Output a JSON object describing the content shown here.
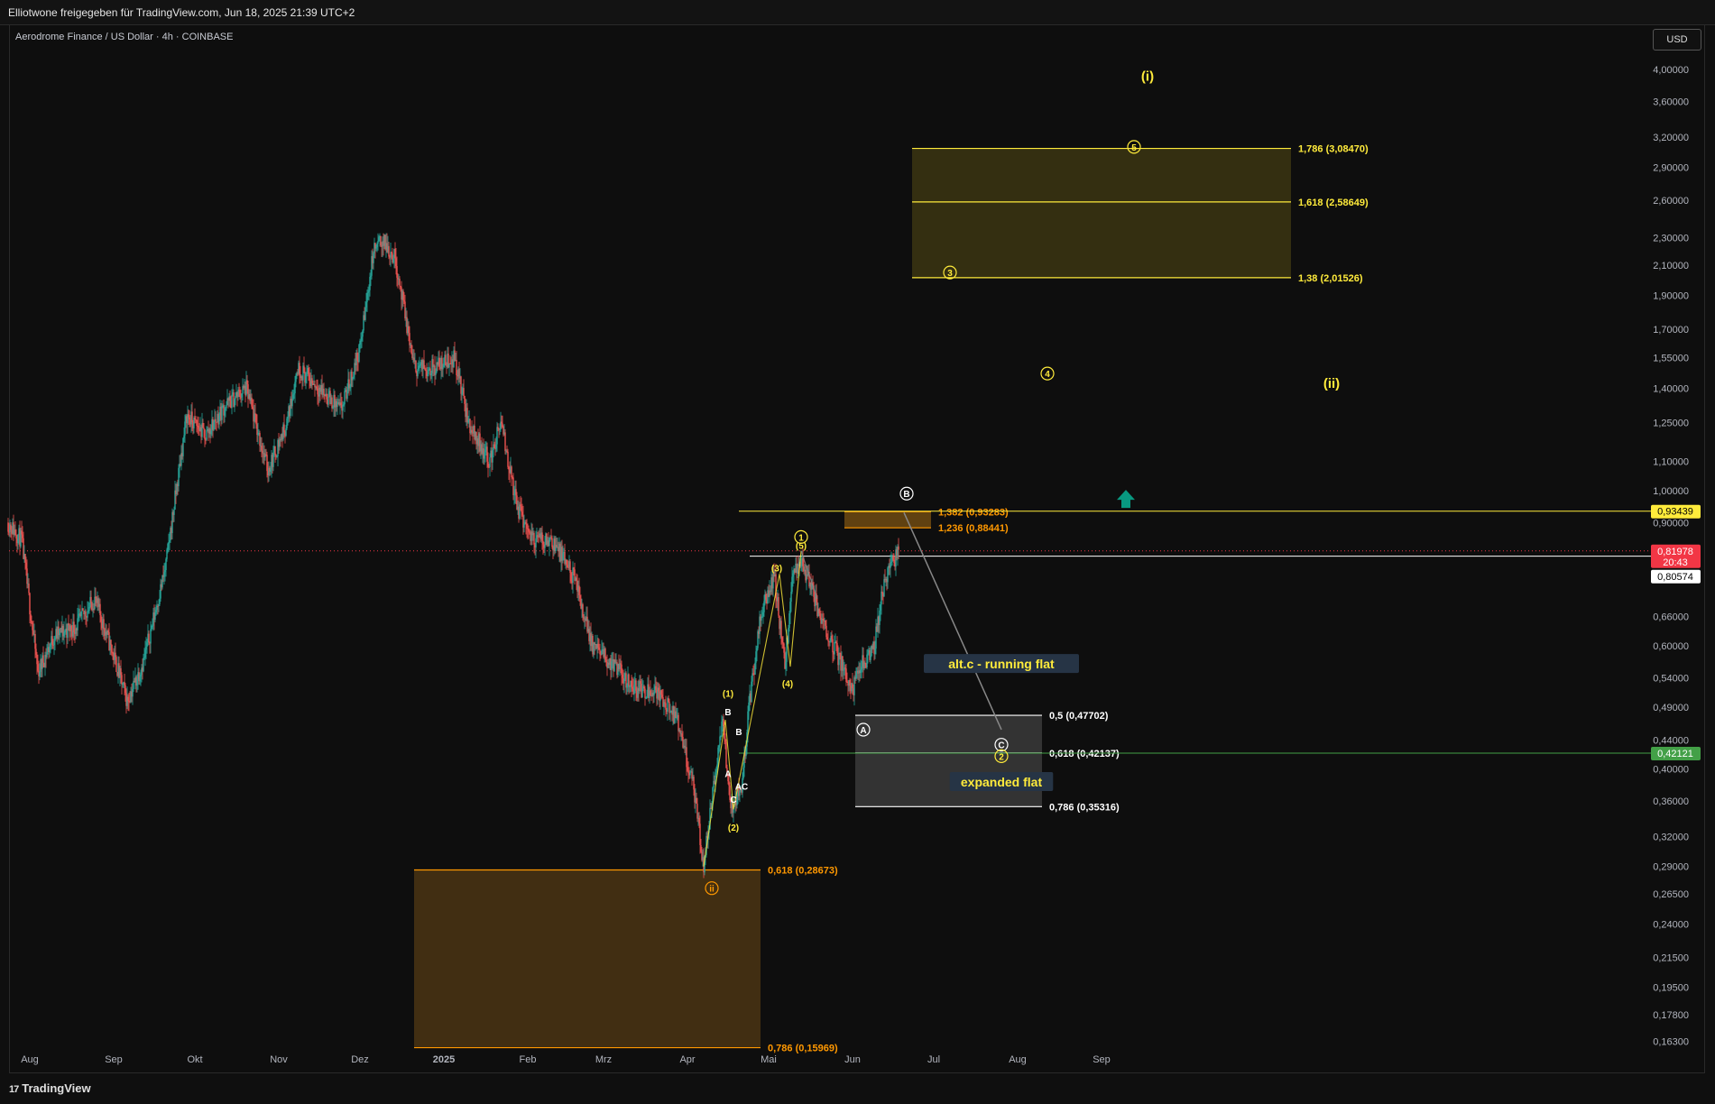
{
  "header": {
    "title": "Elliotwone freigegeben für TradingView.com, Jun 18, 2025 21:39 UTC+2"
  },
  "symbol": {
    "label": "Aerodrome Finance / US Dollar · 4h · COINBASE"
  },
  "currency_button": "USD",
  "branding": {
    "logo_text": "TradingView",
    "logo_mark": "17"
  },
  "colors": {
    "background": "#0e0e0e",
    "up": "#26a69a",
    "down": "#ef5350",
    "yellow": "#ffeb3b",
    "orange": "#ff9800",
    "green": "#43a047",
    "red": "#f23645"
  },
  "chart_data": {
    "type": "candlestick",
    "title": "Aerodrome Finance / US Dollar · 4h · COINBASE",
    "y_scale": "log",
    "ylim": [
      0.159,
      4.6
    ],
    "x_ticks": [
      "Aug",
      "Sep",
      "Okt",
      "Nov",
      "Dez",
      "2025",
      "Feb",
      "Mrz",
      "Apr",
      "Mai",
      "Jun",
      "Jul",
      "Aug",
      "Sep"
    ],
    "y_ticks": [
      "4,00000",
      "3,60000",
      "3,20000",
      "2,90000",
      "2,60000",
      "2,30000",
      "2,10000",
      "1,90000",
      "1,70000",
      "1,55000",
      "1,40000",
      "1,25000",
      "1,10000",
      "1,00000",
      "0,90000",
      "0,66000",
      "0,60000",
      "0,54000",
      "0,49000",
      "0,44000",
      "0,40000",
      "0,36000",
      "0,32000",
      "0,29000",
      "0,26500",
      "0,24000",
      "0,21500",
      "0,19500",
      "0,17800",
      "0,16300"
    ],
    "price_path": [
      [
        "2024-07-24",
        0.9
      ],
      [
        "2024-07-29",
        0.85
      ],
      [
        "2024-08-04",
        0.55
      ],
      [
        "2024-08-10",
        0.62
      ],
      [
        "2024-08-18",
        0.64
      ],
      [
        "2024-08-25",
        0.7
      ],
      [
        "2024-09-01",
        0.58
      ],
      [
        "2024-09-06",
        0.5
      ],
      [
        "2024-09-12",
        0.57
      ],
      [
        "2024-09-20",
        0.77
      ],
      [
        "2024-09-28",
        1.28
      ],
      [
        "2024-10-05",
        1.2
      ],
      [
        "2024-10-12",
        1.32
      ],
      [
        "2024-10-20",
        1.4
      ],
      [
        "2024-10-28",
        1.07
      ],
      [
        "2024-11-04",
        1.25
      ],
      [
        "2024-11-08",
        1.5
      ],
      [
        "2024-11-16",
        1.4
      ],
      [
        "2024-11-24",
        1.3
      ],
      [
        "2024-12-01",
        1.6
      ],
      [
        "2024-12-06",
        2.2
      ],
      [
        "2024-12-09",
        2.28
      ],
      [
        "2024-12-14",
        2.15
      ],
      [
        "2024-12-21",
        1.5
      ],
      [
        "2024-12-28",
        1.5
      ],
      [
        "2025-01-05",
        1.55
      ],
      [
        "2025-01-10",
        1.25
      ],
      [
        "2025-01-18",
        1.1
      ],
      [
        "2025-01-22",
        1.25
      ],
      [
        "2025-01-28",
        0.95
      ],
      [
        "2025-02-03",
        0.85
      ],
      [
        "2025-02-10",
        0.85
      ],
      [
        "2025-02-18",
        0.75
      ],
      [
        "2025-02-25",
        0.6
      ],
      [
        "2025-03-05",
        0.56
      ],
      [
        "2025-03-13",
        0.52
      ],
      [
        "2025-03-20",
        0.52
      ],
      [
        "2025-03-28",
        0.47
      ],
      [
        "2025-04-03",
        0.38
      ],
      [
        "2025-04-07",
        0.29
      ],
      [
        "2025-04-10",
        0.36
      ],
      [
        "2025-04-14",
        0.47
      ],
      [
        "2025-04-17",
        0.35
      ],
      [
        "2025-04-21",
        0.38
      ],
      [
        "2025-04-24",
        0.5
      ],
      [
        "2025-04-28",
        0.66
      ],
      [
        "2025-05-03",
        0.76
      ],
      [
        "2025-05-07",
        0.56
      ],
      [
        "2025-05-10",
        0.76
      ],
      [
        "2025-05-13",
        0.8
      ],
      [
        "2025-05-19",
        0.68
      ],
      [
        "2025-05-25",
        0.6
      ],
      [
        "2025-06-01",
        0.52
      ],
      [
        "2025-06-04",
        0.56
      ],
      [
        "2025-06-09",
        0.6
      ],
      [
        "2025-06-13",
        0.75
      ],
      [
        "2025-06-18",
        0.82
      ]
    ],
    "price_labels": [
      {
        "text": "0,93439",
        "price": 0.93439,
        "color": "#ffeb3b",
        "text_color": "#000000"
      },
      {
        "text": "0,81978",
        "sub": "20:43",
        "price": 0.81978,
        "color": "#f23645",
        "text_color": "#ffffff"
      },
      {
        "text": "0,80574",
        "price": 0.80574,
        "color": "#ffffff",
        "text_color": "#000000"
      },
      {
        "text": "0,42121",
        "price": 0.42121,
        "color": "#43a047",
        "text_color": "#ffffff"
      }
    ],
    "horizontal_lines": [
      {
        "price": 0.93439,
        "from": "2025-04-20",
        "color": "#ffeb3b"
      },
      {
        "price": 0.80574,
        "from": "2025-04-24",
        "color": "#ffffff"
      },
      {
        "price": 0.42121,
        "from": "2025-04-20",
        "color": "#43a047"
      }
    ],
    "zones": [
      {
        "from": "2025-06-23",
        "to": "2025-11-10",
        "top": 3.0847,
        "bottom": 2.01526,
        "color": "#3b3512",
        "border": "#ffeb3b",
        "levels": [
          {
            "label": "1,786 (3,08470)",
            "price": 3.0847
          },
          {
            "label": "1,618 (2,58649)",
            "price": 2.58649
          },
          {
            "label": "1,38 (2,01526)",
            "price": 2.01526
          }
        ],
        "label_color": "#ffeb3b"
      },
      {
        "from": "2025-06-02",
        "to": "2025-08-10",
        "top": 0.47702,
        "bottom": 0.35316,
        "color": "#3a3a3a",
        "border": "#ffffff",
        "levels": [
          {
            "label": "0,5 (0,47702)",
            "price": 0.47702
          },
          {
            "label": "0,618 (0,42137)",
            "price": 0.42137
          },
          {
            "label": "0,786 (0,35316)",
            "price": 0.35316
          }
        ],
        "label_color": "#ffffff"
      },
      {
        "from": "2024-12-21",
        "to": "2025-04-28",
        "top": 0.28673,
        "bottom": 0.15969,
        "color": "#4a3413",
        "border": "#ff9800",
        "levels": [
          {
            "label": "0,618 (0,28673)",
            "price": 0.28673
          },
          {
            "label": "0,786 (0,15969)",
            "price": 0.15969
          }
        ],
        "label_color": "#ff9800"
      },
      {
        "from": "2025-05-29",
        "to": "2025-06-30",
        "top": 0.93283,
        "bottom": 0.88441,
        "color": "#6e4a12",
        "border": "#ff9800",
        "levels": [
          {
            "label": "1,382 (0,93283)",
            "price": 0.93283
          },
          {
            "label": "1,236 (0,88441)",
            "price": 0.88441
          }
        ],
        "label_color": "#ff9800"
      }
    ],
    "wave_labels": [
      {
        "text": "(i)",
        "date": "2025-09-18",
        "price": 3.9,
        "color": "#ffeb3b",
        "style": "plain"
      },
      {
        "text": "5",
        "date": "2025-09-13",
        "price": 3.1,
        "color": "#ffeb3b",
        "style": "circle"
      },
      {
        "text": "3",
        "date": "2025-07-07",
        "price": 2.05,
        "color": "#ffeb3b",
        "style": "circle"
      },
      {
        "text": "4",
        "date": "2025-08-12",
        "price": 1.47,
        "color": "#ffeb3b",
        "style": "circle"
      },
      {
        "text": "(ii)",
        "date": "2025-11-25",
        "price": 1.42,
        "color": "#ffeb3b",
        "style": "plain"
      },
      {
        "text": "B",
        "date": "2025-06-21",
        "price": 0.99,
        "color": "#ffffff",
        "style": "circle"
      },
      {
        "text": "1",
        "date": "2025-05-13",
        "price": 0.858,
        "color": "#ffeb3b",
        "style": "circle"
      },
      {
        "text": "(5)",
        "date": "2025-05-13",
        "price": 0.835,
        "color": "#ffeb3b",
        "style": "plain_small"
      },
      {
        "text": "(3)",
        "date": "2025-05-04",
        "price": 0.775,
        "color": "#ffeb3b",
        "style": "plain_small"
      },
      {
        "text": "(4)",
        "date": "2025-05-08",
        "price": 0.53,
        "color": "#ffeb3b",
        "style": "plain_small"
      },
      {
        "text": "A",
        "date": "2025-06-05",
        "price": 0.455,
        "color": "#ffffff",
        "style": "circle"
      },
      {
        "text": "C",
        "date": "2025-07-26",
        "price": 0.433,
        "color": "#ffffff",
        "style": "circle"
      },
      {
        "text": "2",
        "date": "2025-07-26",
        "price": 0.417,
        "color": "#ffeb3b",
        "style": "circle"
      },
      {
        "text": "(1)",
        "date": "2025-04-16",
        "price": 0.513,
        "color": "#ffeb3b",
        "style": "plain_small"
      },
      {
        "text": "B",
        "date": "2025-04-16",
        "price": 0.483,
        "color": "#ffffff",
        "style": "plain_small"
      },
      {
        "text": "B",
        "date": "2025-04-20",
        "price": 0.452,
        "color": "#ffffff",
        "style": "plain_small"
      },
      {
        "text": "A",
        "date": "2025-04-16",
        "price": 0.394,
        "color": "#ffffff",
        "style": "plain_small"
      },
      {
        "text": "AC",
        "date": "2025-04-21",
        "price": 0.378,
        "color": "#ffffff",
        "style": "plain_small"
      },
      {
        "text": "C",
        "date": "2025-04-18",
        "price": 0.362,
        "color": "#ffffff",
        "style": "plain_small"
      },
      {
        "text": "(2)",
        "date": "2025-04-18",
        "price": 0.33,
        "color": "#ffeb3b",
        "style": "plain_small"
      },
      {
        "text": "ii",
        "date": "2025-04-10",
        "price": 0.27,
        "color": "#ff9800",
        "style": "circle"
      }
    ],
    "annotations": [
      {
        "text": "alt.c - running flat",
        "date": "2025-07-26",
        "price": 0.565,
        "color": "#ffeb3b"
      },
      {
        "text": "expanded flat",
        "date": "2025-07-26",
        "price": 0.383,
        "color": "#ffeb3b"
      }
    ],
    "arrow": {
      "direction": "up",
      "date": "2025-09-10",
      "price": 0.97,
      "color": "#089981"
    },
    "projection_line": {
      "from": [
        "2025-06-20",
        0.93
      ],
      "to": [
        "2025-07-26",
        0.455
      ],
      "color": "#888888"
    },
    "wave_paths": [
      {
        "color": "#ffeb3b",
        "points": [
          [
            "2025-04-07",
            0.29
          ],
          [
            "2025-04-15",
            0.47
          ],
          [
            "2025-04-18",
            0.35
          ],
          [
            "2025-05-05",
            0.76
          ],
          [
            "2025-05-09",
            0.56
          ],
          [
            "2025-05-13",
            0.82
          ]
        ]
      },
      {
        "color": "#888888",
        "points": [
          [
            "2025-05-13",
            0.82
          ],
          [
            "2025-05-19",
            0.7
          ]
        ]
      }
    ]
  }
}
